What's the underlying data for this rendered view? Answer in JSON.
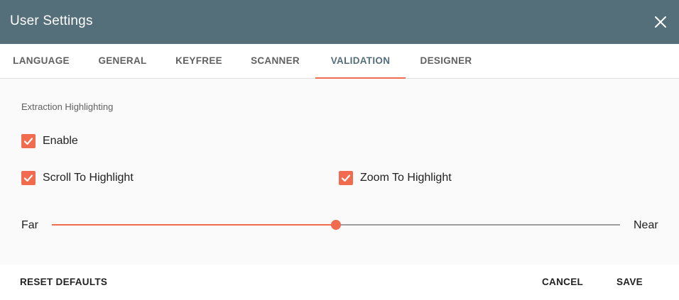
{
  "header": {
    "title": "User Settings",
    "close_icon": "close-icon"
  },
  "tabs": [
    {
      "label": "LANGUAGE",
      "active": false
    },
    {
      "label": "GENERAL",
      "active": false
    },
    {
      "label": "KEYFREE",
      "active": false
    },
    {
      "label": "SCANNER",
      "active": false
    },
    {
      "label": "VALIDATION",
      "active": true
    },
    {
      "label": "DESIGNER",
      "active": false
    }
  ],
  "section": {
    "title": "Extraction Highlighting",
    "enable": {
      "label": "Enable",
      "checked": true
    },
    "scroll_to_highlight": {
      "label": "Scroll To Highlight",
      "checked": true
    },
    "zoom_to_highlight": {
      "label": "Zoom To Highlight",
      "checked": true
    },
    "slider": {
      "min_label": "Far",
      "max_label": "Near",
      "value_fraction": 0.5
    }
  },
  "footer": {
    "reset_label": "RESET DEFAULTS",
    "cancel_label": "CANCEL",
    "save_label": "SAVE"
  },
  "colors": {
    "header_bg": "#546e7a",
    "accent": "#f26b4f"
  }
}
